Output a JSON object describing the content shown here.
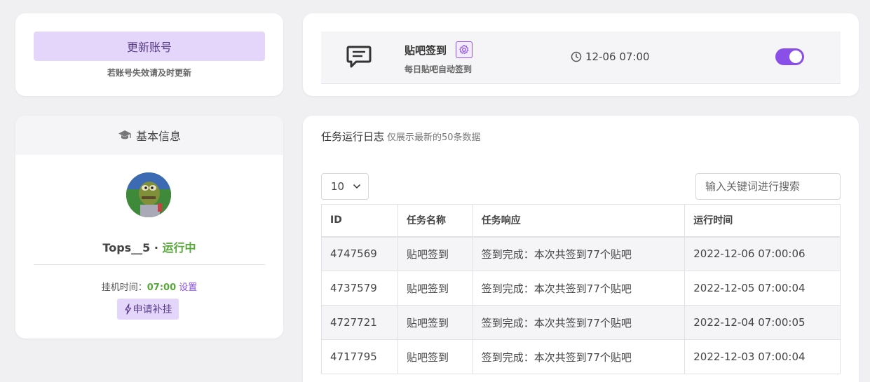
{
  "update_card": {
    "button_label": "更新账号",
    "hint": "若账号失效请及时更新"
  },
  "task_card": {
    "name": "贴吧签到",
    "description": "每日贴吧自动签到",
    "time": "12-06 07:00",
    "enabled": true,
    "icons": {
      "task": "chat-icon",
      "settings": "gear-icon",
      "time": "clock-icon"
    },
    "accent_color": "#8a4fe8"
  },
  "info_card": {
    "header_title": "基本信息",
    "header_icon": "graduation-cap-icon",
    "username": "Tops__5",
    "separator": "·",
    "status": "运行中",
    "status_color": "#57a83a",
    "hang_label": "挂机时间：",
    "hang_time": "07:00",
    "hang_setting_link": "设置",
    "apply_button_label": "申请补挂",
    "apply_icon": "lightning-icon"
  },
  "log_card": {
    "title": "任务运行日志",
    "subtitle": "仅展示最新的50条数据",
    "page_size": "10",
    "search_placeholder": "输入关键词进行搜索",
    "columns": [
      "ID",
      "任务名称",
      "任务响应",
      "运行时间"
    ],
    "rows": [
      {
        "id": "4747569",
        "name": "贴吧签到",
        "response": "签到完成：本次共签到77个贴吧",
        "time": "2022-12-06 07:00:06"
      },
      {
        "id": "4737579",
        "name": "贴吧签到",
        "response": "签到完成：本次共签到77个贴吧",
        "time": "2022-12-05 07:00:04"
      },
      {
        "id": "4727721",
        "name": "贴吧签到",
        "response": "签到完成：本次共签到77个贴吧",
        "time": "2022-12-04 07:00:05"
      },
      {
        "id": "4717795",
        "name": "贴吧签到",
        "response": "签到完成：本次共签到77个贴吧",
        "time": "2022-12-03 07:00:04"
      }
    ]
  }
}
